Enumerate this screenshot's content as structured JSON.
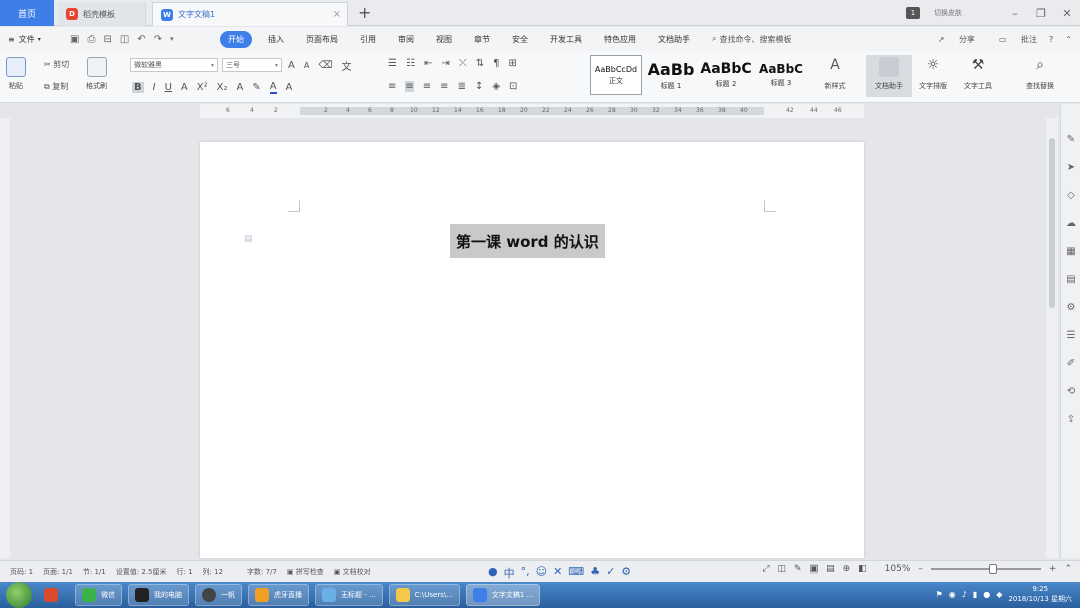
{
  "tabs": {
    "home": "首页",
    "template": "稻壳模板",
    "document": "文字文稿1"
  },
  "title_right": {
    "badge": "1",
    "skin": "切换皮肤"
  },
  "menubar": {
    "file": "文件",
    "items": [
      "开始",
      "插入",
      "页面布局",
      "引用",
      "审阅",
      "视图",
      "章节",
      "安全",
      "开发工具",
      "特色应用",
      "文档助手"
    ],
    "active_index": 0,
    "search": "查找命令、搜索模板",
    "share": "分享",
    "comment": "批注"
  },
  "ribbon": {
    "paste": "粘贴",
    "cut": "剪切",
    "copy": "复制",
    "format_painter": "格式刷",
    "font_name": "微软雅黑",
    "font_size": "三号",
    "styles": [
      {
        "preview": "AaBbCcDd",
        "label": "正文"
      },
      {
        "preview": "AaBb",
        "label": "标题 1"
      },
      {
        "preview": "AaBbC",
        "label": "标题 2"
      },
      {
        "preview": "AaBbC",
        "label": "标题 3"
      }
    ],
    "new_style": "新样式",
    "doc_assistant": "文档助手",
    "text_layout": "文字排版",
    "text_tools": "文字工具",
    "find_replace": "查找替换"
  },
  "ruler": {
    "numbers": [
      "6",
      "4",
      "2",
      "2",
      "4",
      "6",
      "8",
      "10",
      "12",
      "14",
      "16",
      "18",
      "20",
      "22",
      "24",
      "26",
      "28",
      "30",
      "32",
      "34",
      "36",
      "38",
      "40",
      "42",
      "44",
      "46"
    ]
  },
  "document": {
    "title": "第一课 word 的认识"
  },
  "statusbar": {
    "page_num": "页码: 1",
    "pages": "页面: 1/1",
    "section": "节: 1/1",
    "setting": "设置值: 2.5厘米",
    "row": "行: 1",
    "col": "列: 12",
    "words": "字数: 7/7",
    "spell": "拼写检查",
    "proof": "文档校对",
    "zoom": "105%"
  },
  "taskbar": {
    "items": [
      "微信",
      "我的电脑",
      "一帆",
      "虎牙直播",
      "无标题 - ...",
      "C:\\Users\\...",
      "文字文稿1 ..."
    ],
    "time": "9:25",
    "date": "2018/10/13 星期六"
  }
}
